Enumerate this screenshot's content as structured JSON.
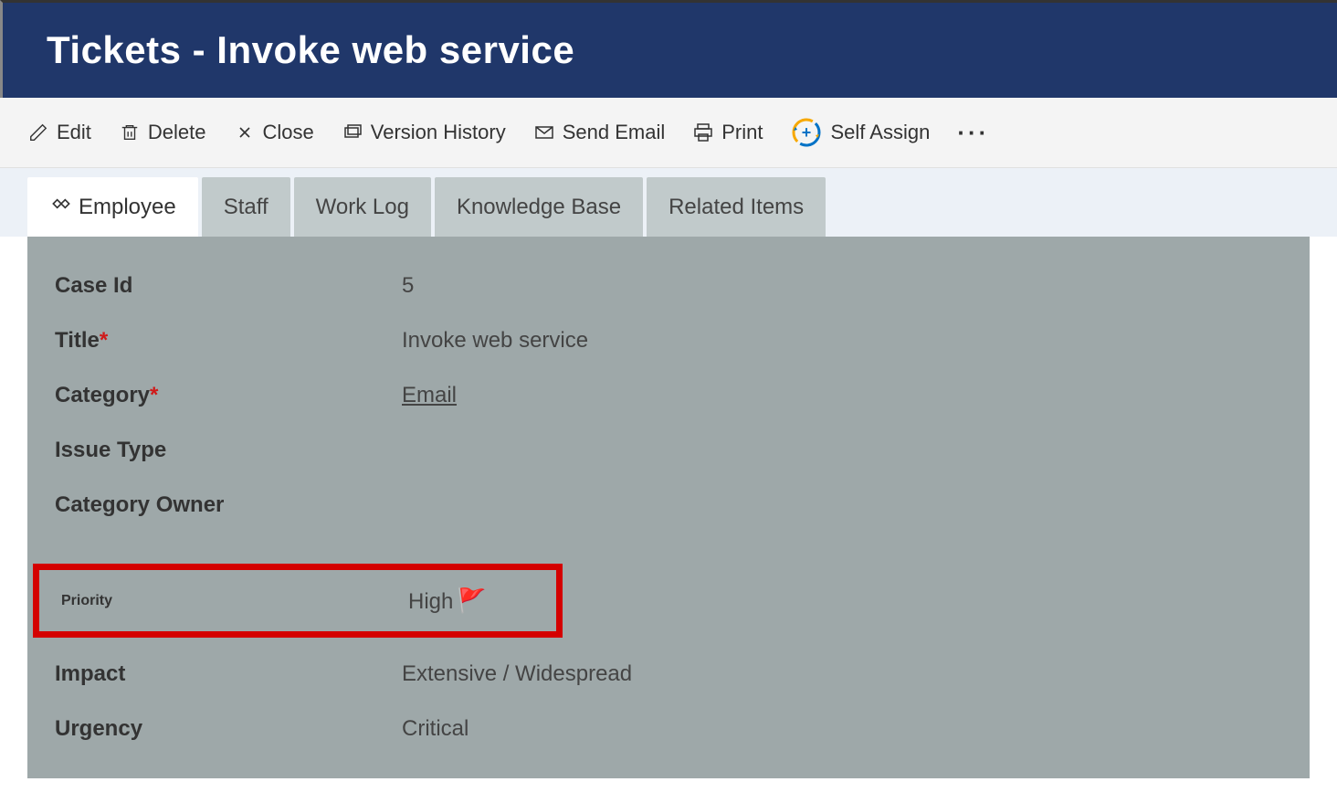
{
  "header": {
    "title": "Tickets - Invoke web service"
  },
  "toolbar": {
    "edit": "Edit",
    "delete": "Delete",
    "close": "Close",
    "version_history": "Version History",
    "send_email": "Send Email",
    "print": "Print",
    "self_assign": "Self Assign"
  },
  "tabs": {
    "employee": "Employee",
    "staff": "Staff",
    "work_log": "Work Log",
    "knowledge_base": "Knowledge Base",
    "related_items": "Related Items"
  },
  "fields": {
    "case_id": {
      "label": "Case Id",
      "value": "5"
    },
    "title": {
      "label": "Title",
      "value": "Invoke web service"
    },
    "category": {
      "label": "Category",
      "value": "Email"
    },
    "issue_type": {
      "label": "Issue Type",
      "value": ""
    },
    "category_owner": {
      "label": "Category Owner",
      "value": ""
    },
    "priority": {
      "label": "Priority",
      "value": "High"
    },
    "impact": {
      "label": "Impact",
      "value": "Extensive / Widespread"
    },
    "urgency": {
      "label": "Urgency",
      "value": "Critical"
    }
  }
}
